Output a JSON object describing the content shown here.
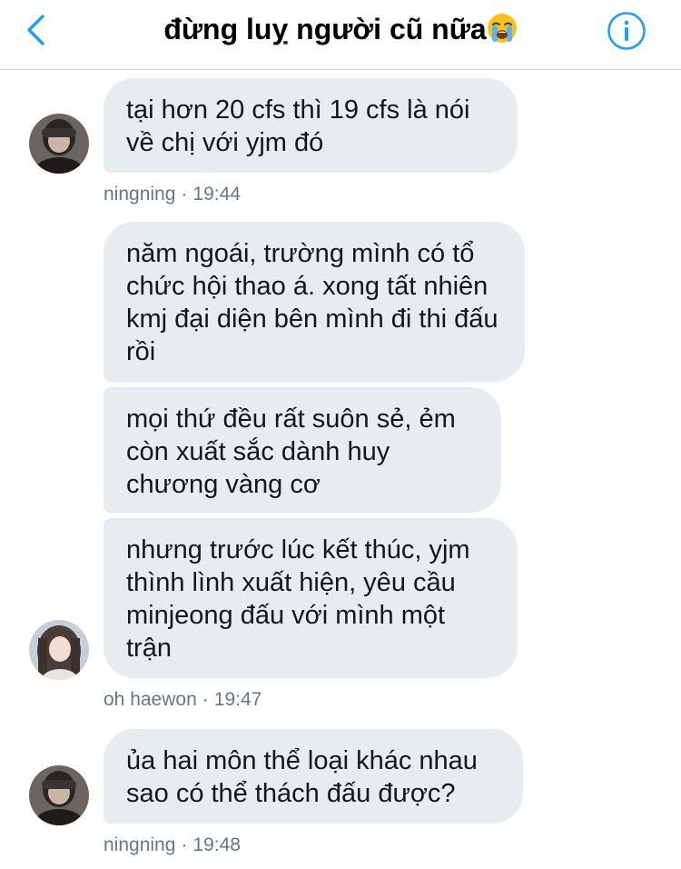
{
  "header": {
    "title": "đừng luỵ người cũ nữa",
    "back_icon": "chevron-left-icon",
    "title_emoji": "loudly-crying-face",
    "info_icon": "info-icon",
    "accent_color": "#1da1f2"
  },
  "messages": [
    {
      "text": "tại hơn 20 cfs thì 19 cfs là nói về chị với yjm đó"
    },
    {
      "text": "năm ngoái, trường mình có tổ chức hội thao á. xong tất nhiên kmj đại diện bên mình đi thi đấu rồi"
    },
    {
      "text": "mọi thứ đều rất suôn sẻ, ẻm còn xuất sắc dành huy chương vàng cơ"
    },
    {
      "text": "nhưng trước lúc kết thúc, yjm thình lình xuất hiện, yêu cầu minjeong đấu với mình một trận"
    },
    {
      "text": "ủa hai môn thể loại khác nhau sao có thể thách đấu được?"
    }
  ],
  "meta": [
    {
      "sender": "ningning",
      "separator": "·",
      "time": "19:44"
    },
    {
      "sender": "oh haewon",
      "separator": "·",
      "time": "19:47"
    },
    {
      "sender": "ningning",
      "separator": "·",
      "time": "19:48"
    }
  ],
  "colors": {
    "bubble_bg": "#e6ecf0",
    "meta_text": "#657786"
  }
}
